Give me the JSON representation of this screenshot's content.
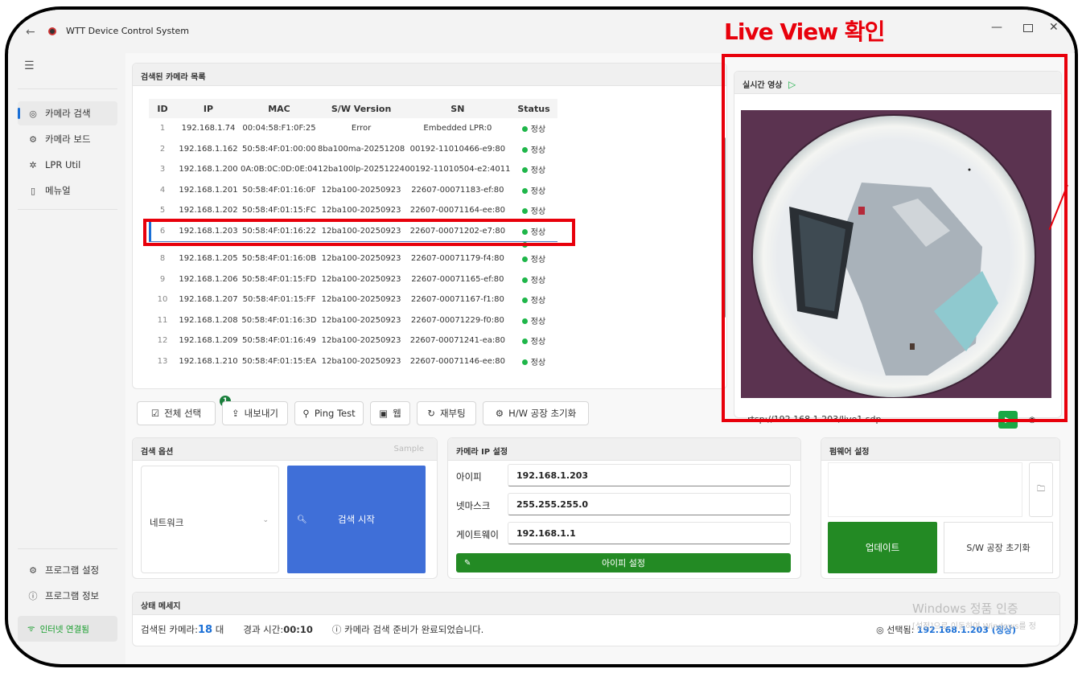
{
  "window": {
    "title": "WTT Device Control System",
    "back_glyph": "←",
    "minimize_glyph": "—",
    "close_glyph": "✕"
  },
  "annotation": {
    "title": "Live View 확인",
    "color": "#e8000b"
  },
  "sidebar": {
    "items": [
      {
        "label": "카메라 검색",
        "icon": "camera-icon",
        "glyph": "◎",
        "active": true
      },
      {
        "label": "카메라 보드",
        "icon": "board-icon",
        "glyph": "⚙",
        "active": false
      },
      {
        "label": "LPR Util",
        "icon": "lpr-icon",
        "glyph": "✲",
        "active": false
      },
      {
        "label": "메뉴얼",
        "icon": "manual-icon",
        "glyph": "▯",
        "active": false
      }
    ],
    "bottom_items": [
      {
        "label": "프로그램 설정",
        "icon": "gear-icon",
        "glyph": "⚙"
      },
      {
        "label": "프로그램 정보",
        "icon": "info-icon",
        "glyph": "ⓘ"
      }
    ],
    "network_status": "인터넷 연결됨",
    "network_glyph": "ᯤ"
  },
  "camera_list": {
    "title": "검색된 카메라 목록",
    "columns": [
      "ID",
      "IP",
      "MAC",
      "S/W Version",
      "SN",
      "Status"
    ],
    "rows": [
      [
        "1",
        "192.168.1.74",
        "00:04:58:F1:0F:25",
        "Error",
        "Embedded LPR:0",
        "정상"
      ],
      [
        "2",
        "192.168.1.162",
        "50:58:4F:01:00:00",
        "8ba100ma-20251208",
        "00192-11010466-e9:80",
        "정상"
      ],
      [
        "3",
        "192.168.1.200",
        "0A:0B:0C:0D:0E:04",
        "12ba100lp-20251224",
        "00192-11010504-e2:4011",
        "정상"
      ],
      [
        "4",
        "192.168.1.201",
        "50:58:4F:01:16:0F",
        "12ba100-20250923",
        "22607-00071183-ef:80",
        "정상"
      ],
      [
        "5",
        "192.168.1.202",
        "50:58:4F:01:15:FC",
        "12ba100-20250923",
        "22607-00071164-ee:80",
        "정상"
      ],
      [
        "6",
        "192.168.1.203",
        "50:58:4F:01:16:22",
        "12ba100-20250923",
        "22607-00071202-e7:80",
        "정상"
      ],
      [
        "7",
        "192.168.1.204",
        "50:58:4F:01:15:FE",
        "12ba100-20250923",
        "22607-00071166-f0:80",
        "정상"
      ],
      [
        "8",
        "192.168.1.205",
        "50:58:4F:01:16:0B",
        "12ba100-20250923",
        "22607-00071179-f4:80",
        "정상"
      ],
      [
        "9",
        "192.168.1.206",
        "50:58:4F:01:15:FD",
        "12ba100-20250923",
        "22607-00071165-ef:80",
        "정상"
      ],
      [
        "10",
        "192.168.1.207",
        "50:58:4F:01:15:FF",
        "12ba100-20250923",
        "22607-00071167-f1:80",
        "정상"
      ],
      [
        "11",
        "192.168.1.208",
        "50:58:4F:01:16:3D",
        "12ba100-20250923",
        "22607-00071229-f0:80",
        "정상"
      ],
      [
        "12",
        "192.168.1.209",
        "50:58:4F:01:16:49",
        "12ba100-20250923",
        "22607-00071241-ea:80",
        "정상"
      ],
      [
        "13",
        "192.168.1.210",
        "50:58:4F:01:15:EA",
        "12ba100-20250923",
        "22607-00071146-ee:80",
        "정상"
      ]
    ],
    "selected_row": 6,
    "partially_hidden_row": 7
  },
  "actions": {
    "select_all": "전체 선택",
    "select_all_badge": "1",
    "export": "내보내기",
    "ping": "Ping Test",
    "web": "웹",
    "reboot": "재부팅",
    "factory_reset": "H/W 공장 초기화"
  },
  "live_view": {
    "title": "실시간 영상",
    "stream_url": "rtsp://192.168.1.203/live1.sdp"
  },
  "search_options": {
    "title": "검색 옵션",
    "sample_label": "Sample",
    "selected_value": "네트워크",
    "button_label": "검색 시작"
  },
  "ip_settings": {
    "title": "카메라 IP 설정",
    "fields": [
      {
        "label": "아이피",
        "value": "192.168.1.203"
      },
      {
        "label": "넷마스크",
        "value": "255.255.255.0"
      },
      {
        "label": "게이트웨이",
        "value": "192.168.1.1"
      }
    ],
    "apply_label": "아이피 설정"
  },
  "firmware": {
    "title": "펌웨어 설정",
    "update_label": "업데이트",
    "reset_label": "S/W 공장 초기화"
  },
  "status": {
    "title": "상태 메세지",
    "found_prefix": "검색된 카메라:",
    "found_count": "18",
    "found_suffix": "대",
    "elapsed_prefix": "경과 시간:",
    "elapsed_value": "00:10",
    "message": "카메라 검색 준비가 완료되었습니다.",
    "selected_prefix": "선택됨:",
    "selected_value": "192.168.1.203 (정상)"
  },
  "watermark": {
    "line1": "Windows 정품 인증",
    "line2": "[설정]으로 이동하여 Windows를 정"
  }
}
